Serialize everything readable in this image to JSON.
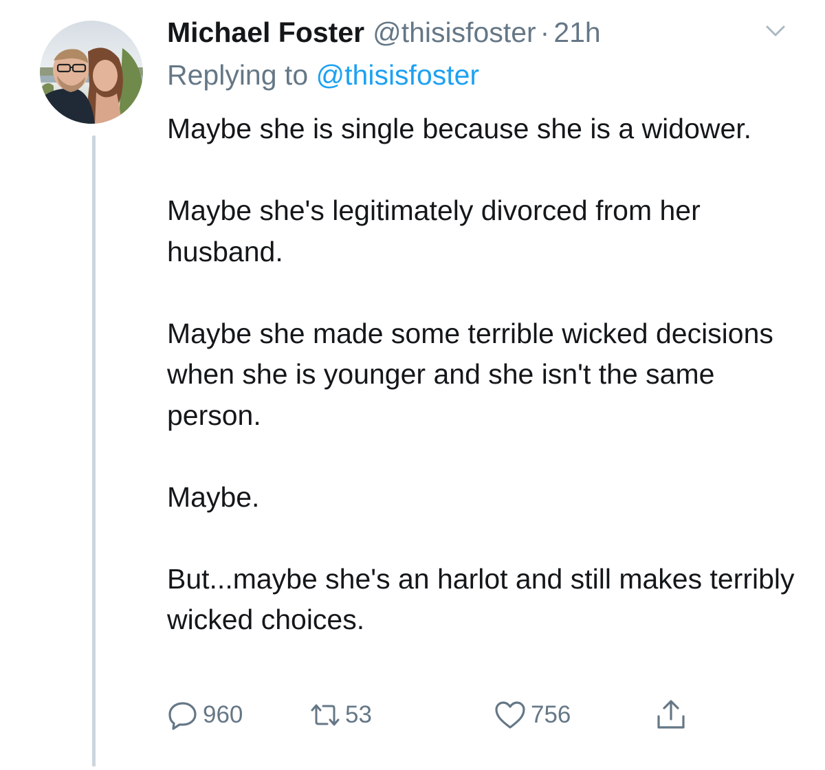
{
  "tweet": {
    "author_name": "Michael Foster",
    "author_handle": "@thisisfoster",
    "separator": "·",
    "timestamp": "21h",
    "replying_prefix": "Replying to ",
    "replying_handle": "@thisisfoster",
    "paragraphs": [
      "Maybe she is single because she is a widower.",
      "Maybe she's legitimately divorced from her husband.",
      "Maybe she made some terrible wicked decisions when she is younger and she isn't the same person.",
      "Maybe.",
      "But...maybe she's an harlot and still makes terribly wicked choices."
    ]
  },
  "actions": {
    "replies": "960",
    "retweets": "53",
    "likes": "756"
  },
  "icons": {
    "more": "chevron-down-icon",
    "reply": "reply-bubble-icon",
    "retweet": "retweet-icon",
    "like": "heart-icon",
    "share": "share-icon"
  },
  "colors": {
    "text": "#14171a",
    "secondary": "#657786",
    "link": "#1da1f2",
    "thread_line": "#ccd6dd",
    "icon_light": "#aab8c2"
  }
}
